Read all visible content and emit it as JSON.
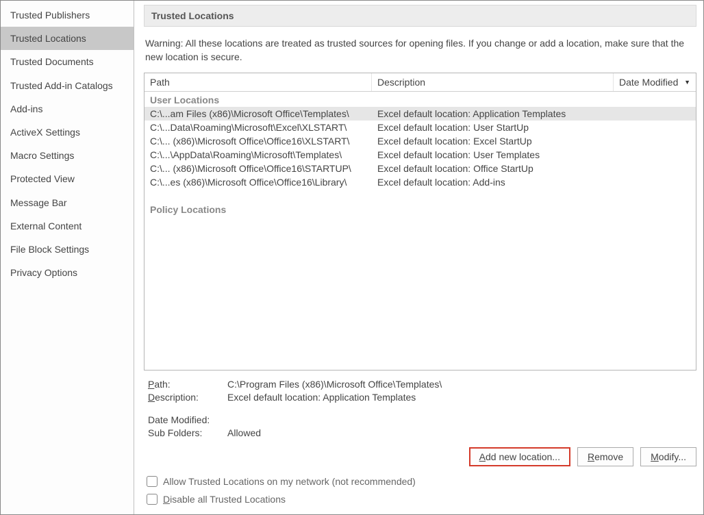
{
  "sidebar": {
    "items": [
      {
        "label": "Trusted Publishers",
        "selected": false
      },
      {
        "label": "Trusted Locations",
        "selected": true
      },
      {
        "label": "Trusted Documents",
        "selected": false
      },
      {
        "label": "Trusted Add-in Catalogs",
        "selected": false
      },
      {
        "label": "Add-ins",
        "selected": false
      },
      {
        "label": "ActiveX Settings",
        "selected": false
      },
      {
        "label": "Macro Settings",
        "selected": false
      },
      {
        "label": "Protected View",
        "selected": false
      },
      {
        "label": "Message Bar",
        "selected": false
      },
      {
        "label": "External Content",
        "selected": false
      },
      {
        "label": "File Block Settings",
        "selected": false
      },
      {
        "label": "Privacy Options",
        "selected": false
      }
    ]
  },
  "main": {
    "title": "Trusted Locations",
    "warning": "Warning: All these locations are treated as trusted sources for opening files.  If you change or add a location, make sure that the new location is secure.",
    "columns": {
      "path": "Path",
      "description": "Description",
      "date": "Date Modified"
    },
    "section_user": "User Locations",
    "section_policy": "Policy Locations",
    "rows": [
      {
        "path": "C:\\...am Files (x86)\\Microsoft Office\\Templates\\",
        "desc": "Excel default location: Application Templates",
        "selected": true
      },
      {
        "path": "C:\\...Data\\Roaming\\Microsoft\\Excel\\XLSTART\\",
        "desc": "Excel default location: User StartUp",
        "selected": false
      },
      {
        "path": "C:\\... (x86)\\Microsoft Office\\Office16\\XLSTART\\",
        "desc": "Excel default location: Excel StartUp",
        "selected": false
      },
      {
        "path": "C:\\...\\AppData\\Roaming\\Microsoft\\Templates\\",
        "desc": "Excel default location: User Templates",
        "selected": false
      },
      {
        "path": "C:\\... (x86)\\Microsoft Office\\Office16\\STARTUP\\",
        "desc": "Excel default location: Office StartUp",
        "selected": false
      },
      {
        "path": "C:\\...es (x86)\\Microsoft Office\\Office16\\Library\\",
        "desc": "Excel default location: Add-ins",
        "selected": false
      }
    ],
    "details": {
      "path_label": "Path:",
      "path_value": "C:\\Program Files (x86)\\Microsoft Office\\Templates\\",
      "desc_label": "Description:",
      "desc_value": "Excel default location: Application Templates",
      "date_label": "Date Modified:",
      "date_value": "",
      "sub_label": "Sub Folders:",
      "sub_value": "Allowed"
    },
    "buttons": {
      "add": "Add new location...",
      "remove": "Remove",
      "modify": "Modify..."
    },
    "checkboxes": {
      "allow_network": "Allow Trusted Locations on my network (not recommended)",
      "disable_all": "Disable all Trusted Locations"
    }
  }
}
